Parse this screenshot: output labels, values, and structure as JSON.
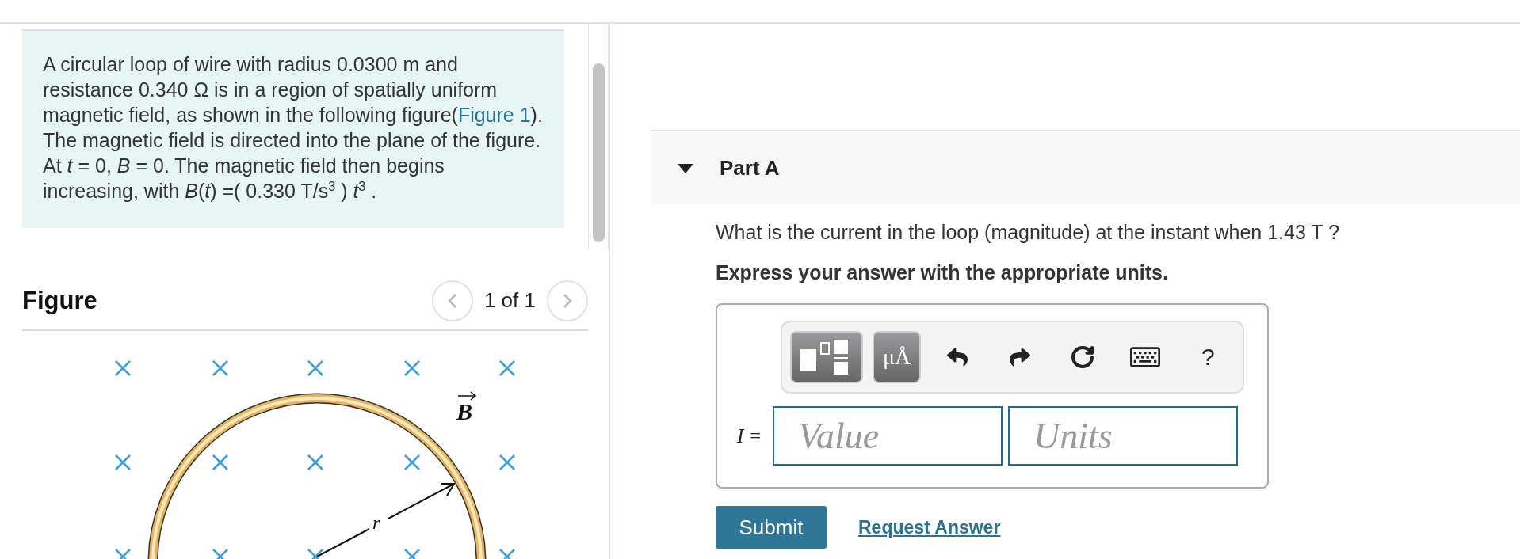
{
  "problem": {
    "text_before": "A circular loop of wire with radius 0.0300 m and resistance 0.340 Ω is in a region of spatially uniform magnetic field, as shown in the following figure(",
    "link": "Figure 1",
    "text_after": "). The magnetic field is directed into the plane of the figure. At *t* = 0, *B* = 0. The magnetic field then begins increasing, with *B*(*t*) =( 0.330 T/s$^{3}$ ) *t*$^{3}$ ."
  },
  "figure": {
    "title": "Figure",
    "pager": "1 of 1",
    "field_label": "B",
    "radius_label": "r"
  },
  "part": {
    "title": "Part A",
    "expanded": true,
    "question": "What is the current in the loop (magnitude) at the instant when 1.43 T ?",
    "instruction": "Express your answer with the appropriate units.",
    "toolbar": [
      {
        "kind": "templates"
      },
      {
        "kind": "units",
        "label": "μÅ"
      },
      {
        "kind": "undo"
      },
      {
        "kind": "redo"
      },
      {
        "kind": "reset"
      },
      {
        "kind": "keyboard"
      },
      {
        "kind": "help",
        "label": "?"
      }
    ],
    "variable": "I =",
    "value_placeholder": "Value",
    "units_placeholder": "Units",
    "submit": "Submit",
    "request_answer": "Request Answer"
  }
}
